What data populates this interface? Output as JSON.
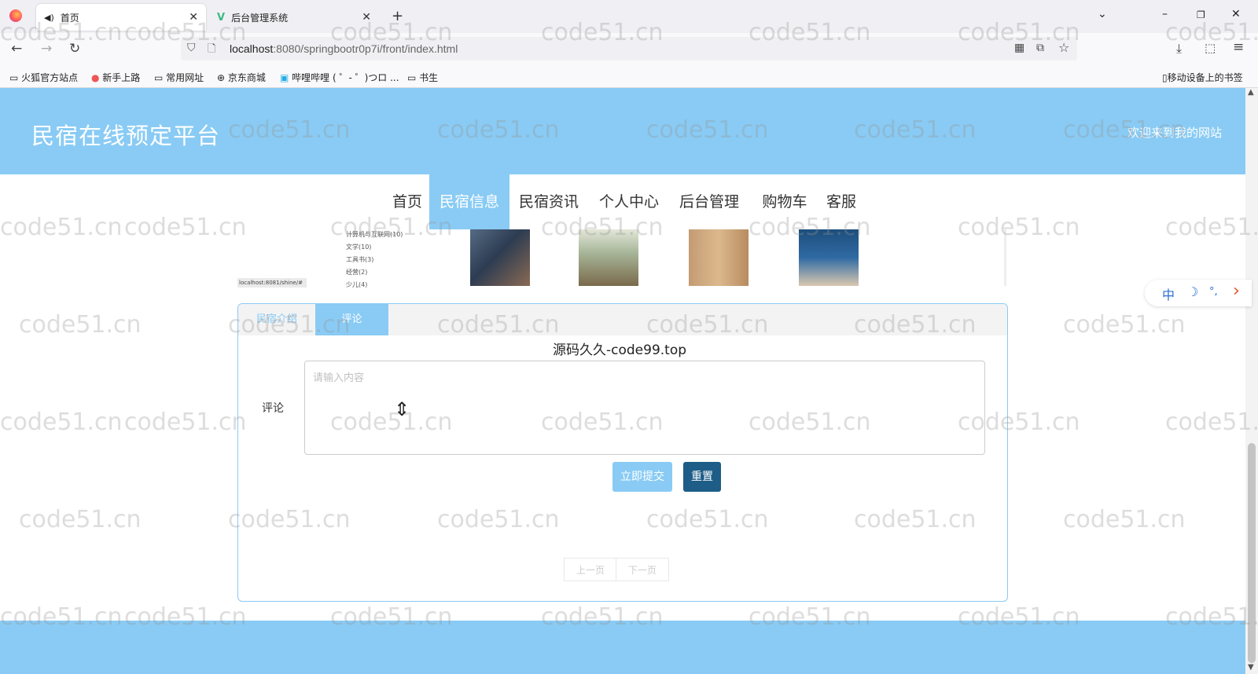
{
  "browser": {
    "tabs": [
      {
        "label": "首页",
        "icon": "speaker-icon"
      },
      {
        "label": "后台管理系统",
        "icon": "vue-logo-icon"
      }
    ],
    "new_tab_symbol": "+",
    "url_host": "localhost",
    "url_rest": ":8080/springbootr0p7i/front/index.html",
    "bookmarks": [
      "火狐官方站点",
      "新手上路",
      "常用网址",
      "京东商城",
      "哔哩哔哩 ( ゜- ゜)つロ ...",
      "书生"
    ],
    "mobile_bookmarks": "移动设备上的书签"
  },
  "header": {
    "site_title": "民宿在线预定平台",
    "welcome": "欢迎来到我的网站"
  },
  "nav": {
    "items": [
      "首页",
      "民宿信息",
      "民宿资讯",
      "个人中心",
      "后台管理",
      "购物车",
      "客服"
    ],
    "active": "民宿信息"
  },
  "strip": {
    "categories": [
      "计算机与互联网(10)",
      "文学(10)",
      "工具书(3)",
      "经营(2)",
      "少儿(4)"
    ],
    "local_url": "localhost:8081/shine/#"
  },
  "panel": {
    "tabs": [
      "民宿介绍",
      "评论"
    ],
    "active_tab": "评论",
    "overlay_text": "源码久久-code99.top",
    "comment_label": "评论",
    "comment_placeholder": "请输入内容",
    "submit_label": "立即提交",
    "reset_label": "重置",
    "prev_label": "上一页",
    "next_label": "下一页"
  },
  "ime": {
    "lang": "中",
    "moon": "☽",
    "punct": "°,",
    "arrow": "›"
  },
  "watermark": "code51.cn",
  "colors": {
    "accent": "#89cbf4",
    "dark_button": "#1d5d87"
  }
}
